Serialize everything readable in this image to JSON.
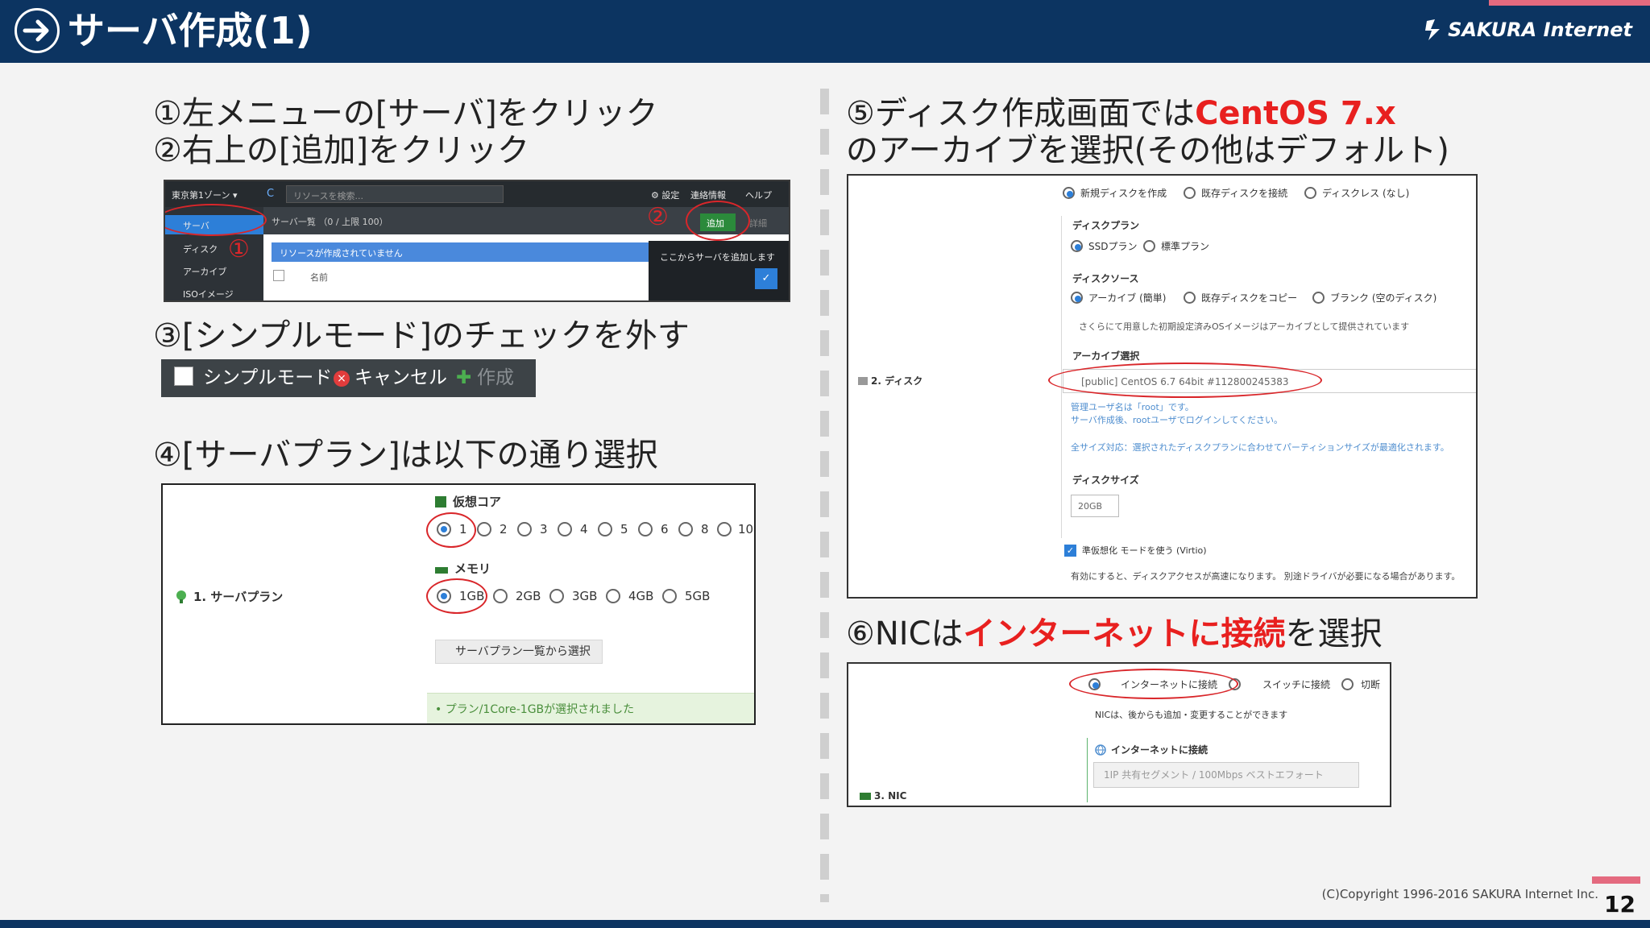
{
  "header": {
    "title": "サーバ作成(1)",
    "logo_text": "SAKURA Internet",
    "colors": {
      "bar": "#0c3461",
      "accent": "#e46a7f",
      "highlight": "#e8201f"
    }
  },
  "steps": {
    "s1a": "①左メニューの[サーバ]をクリック",
    "s1b": "②右上の[追加]をクリック",
    "s3": "③[シンプルモード]のチェックを外す",
    "s4": "④[サーバプラン]は以下の通り選択",
    "s5_prefix": "⑤ディスク作成画面では",
    "s5_highlight": "CentOS 7.x",
    "s5_line2": "のアーカイブを選択(その他はデフォルト)",
    "s6_prefix": "⑥NICは",
    "s6_highlight": "インターネットに接続",
    "s6_suffix": "を選択"
  },
  "shot1": {
    "zone": "東京第1ゾーン ▾",
    "refresh": "C",
    "search_placeholder": "リソースを検索...",
    "menu_settings": "⚙ 設定",
    "menu_notice": "連絡情報",
    "menu_help": "ヘルプ",
    "sidebar": [
      "サーバ",
      "ディスク",
      "アーカイブ",
      "ISOイメージ"
    ],
    "list_title": "サーバ一覧 （0 / 上限 100）",
    "add_button": "追加",
    "detail_button": "詳細",
    "empty_message": "リソースが作成されていません",
    "column_name": "名前",
    "tooltip": "ここからサーバを追加します",
    "check": "✓",
    "annotation_1": "①",
    "annotation_2": "②"
  },
  "shot2": {
    "simple_mode": "シンプルモード",
    "cancel": "キャンセル",
    "cancel_icon": "×",
    "create_icon": "✚",
    "create": "作成"
  },
  "shot3": {
    "row_label": "1. サーバプラン",
    "core_label": "仮想コア",
    "core_options": [
      "1",
      "2",
      "3",
      "4",
      "5",
      "6",
      "8",
      "10"
    ],
    "memory_label": "メモリ",
    "memory_options": [
      "1GB",
      "2GB",
      "3GB",
      "4GB",
      "5GB"
    ],
    "plan_list_button": "サーバプラン一覧から選択",
    "selected_message": "• プラン/1Core-1GBが選択されました"
  },
  "shot4": {
    "row_label": "2. ディスク",
    "disk_options": [
      "新規ディスクを作成",
      "既存ディスクを接続",
      "ディスクレス (なし)"
    ],
    "plan_label": "ディスクプラン",
    "plan_options": [
      "SSDプラン",
      "標準プラン"
    ],
    "source_label": "ディスクソース",
    "source_options": [
      "アーカイブ (簡単)",
      "既存ディスクをコピー",
      "ブランク (空のディスク)"
    ],
    "source_note": "さくらにて用意した初期設定済みOSイメージはアーカイブとして提供されています",
    "archive_label": "アーカイブ選択",
    "archive_value": "[public] CentOS 6.7 64bit #112800245383",
    "admin_note_1": "管理ユーザ名は「root」です。",
    "admin_note_2": "サーバ作成後、rootユーザでログインしてください。",
    "size_note": "全サイズ対応：選択されたディスクプランに合わせてパーティションサイズが最適化されます。",
    "size_label": "ディスクサイズ",
    "size_value": "20GB",
    "virtio_label": "準仮想化 モードを使う (Virtio)",
    "virtio_check": "✓",
    "virtio_note": "有効にすると、ディスクアクセスが高速になります。 別途ドライバが必要になる場合があります。"
  },
  "shot5": {
    "row_label": "3. NIC",
    "nic_options": [
      "インターネットに接続",
      "スイッチに接続",
      "切断"
    ],
    "note": "NICは、後からも追加・変更することができます",
    "section_label": "インターネットに接続",
    "field_value": "1IP 共有セグメント / 100Mbps ベストエフォート"
  },
  "footer": {
    "copyright": "(C)Copyright 1996-2016 SAKURA Internet Inc.",
    "page_number": "12"
  }
}
